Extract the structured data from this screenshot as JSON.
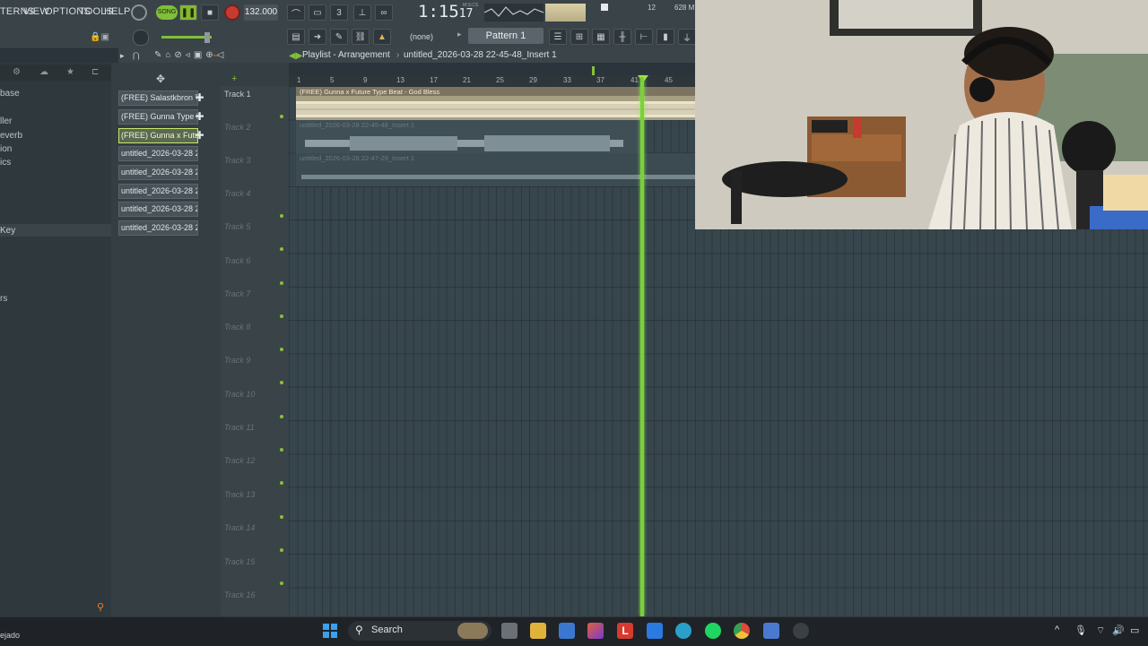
{
  "menu": {
    "patterns": "TERNS",
    "view": "VIEW",
    "options": "OPTIONS",
    "tools": "TOOLS",
    "help": "HELP"
  },
  "transport": {
    "mode_label": "SONG",
    "tempo": "132.000",
    "time": "1:15",
    "time_small": "17",
    "time_unit": "M:S:CS"
  },
  "meters": {
    "cpu": "12",
    "memory": "628 M"
  },
  "toolbar": {
    "snap": "(none)",
    "pattern": "Pattern 1"
  },
  "playlist": {
    "title": "Playlist - Arrangement",
    "breadcrumb": "untitled_2026-03-28 22-45-48_Insert 1",
    "arrow": "›"
  },
  "ruler": [
    "1",
    "5",
    "9",
    "13",
    "17",
    "21",
    "25",
    "29",
    "33",
    "37",
    "41",
    "45"
  ],
  "browser": [
    {
      "label": "base"
    },
    {
      "label": "ller"
    },
    {
      "label": "everb"
    },
    {
      "label": "ion"
    },
    {
      "label": "ics"
    },
    {
      "label": "Key"
    },
    {
      "label": "rs"
    }
  ],
  "channels": [
    {
      "label": "(FREE) Salastkbron T..."
    },
    {
      "label": "(FREE) Gunna Type B..."
    },
    {
      "label": "(FREE) Gunna x Futur..."
    },
    {
      "label": "untitled_2026-03-28 22-..."
    },
    {
      "label": "untitled_2026-03-28 22-..."
    },
    {
      "label": "untitled_2026-03-28 22-..."
    },
    {
      "label": "untitled_2026-03-28 22-..."
    },
    {
      "label": "untitled_2026-03-28 22-..."
    }
  ],
  "tracks": [
    "Track 1",
    "Track 2",
    "Track 3",
    "Track 4",
    "Track 5",
    "Track 6",
    "Track 7",
    "Track 8",
    "Track 9",
    "Track 10",
    "Track 11",
    "Track 12",
    "Track 13",
    "Track 14",
    "Track 15",
    "Track 16"
  ],
  "clips": [
    {
      "label": "(FREE) Gunna x Future Type Beat - God Bless"
    },
    {
      "label": "untitled_2026-03-28 22-45-48_Insert 1"
    },
    {
      "label": "untitled_2026-03-28 22-47-29_Insert 1"
    }
  ],
  "taskbar": {
    "search": "Search",
    "status_left": "ejado"
  },
  "colors": {
    "accent_green": "#86c23a",
    "playhead": "#79d23a",
    "record": "#d9443a",
    "clip_gold": "#c9b98f"
  }
}
